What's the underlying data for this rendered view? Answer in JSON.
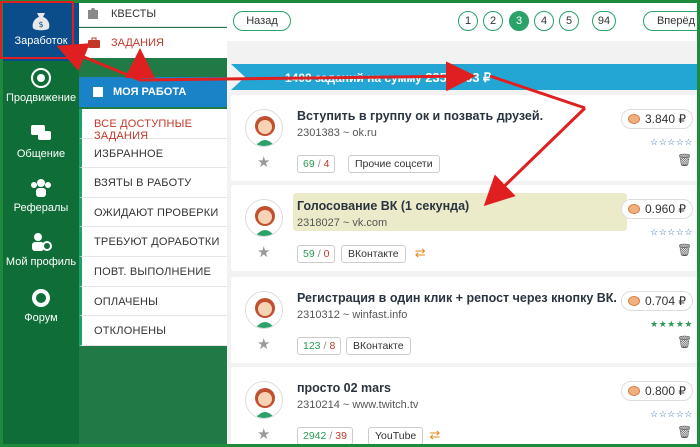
{
  "nav": {
    "items": [
      {
        "label": "Заработок",
        "icon": "money-bag-icon",
        "active": true
      },
      {
        "label": "Продвижение",
        "icon": "target-icon"
      },
      {
        "label": "Общение",
        "icon": "chat-icon"
      },
      {
        "label": "Рефералы",
        "icon": "people-icon"
      },
      {
        "label": "Мой профиль",
        "icon": "user-gear-icon"
      },
      {
        "label": "Форум",
        "icon": "forum-icon"
      }
    ]
  },
  "submenu": {
    "quests": "КВЕСТЫ",
    "tasks": "ЗАДАНИЯ",
    "my_work": "МОЯ РАБОТА",
    "items": [
      "ВСЕ ДОСТУПНЫЕ ЗАДАНИЯ",
      "ИЗБРАННОЕ",
      "ВЗЯТЫ В РАБОТУ",
      "ОЖИДАЮТ ПРОВЕРКИ",
      "ТРЕБУЮТ ДОРАБОТКИ",
      "ПОВТ. ВЫПОЛНЕНИЕ",
      "ОПЛАЧЕНЫ",
      "ОТКЛОНЕНЫ"
    ]
  },
  "pager": {
    "back": "Назад",
    "pages": [
      "1",
      "2",
      "3",
      "4",
      "5",
      "94"
    ],
    "current": "3",
    "forward": "Вперёд"
  },
  "banner": {
    "count_text": "1408 заданий на сумму",
    "sum": "2356.563 ₽"
  },
  "tasks": [
    {
      "title": "Вступить в группу ок и позвать друзей.",
      "id_site": "2301383 ~ ok.ru",
      "done": "69",
      "rejected": "4",
      "category": "Прочие соцсети",
      "price": "3.840 ₽",
      "stars": "☆☆☆☆☆",
      "repeat": false,
      "highlight": false
    },
    {
      "title": "Голосование ВК (1 секунда)",
      "id_site": "2318027 ~ vk.com",
      "done": "59",
      "rejected": "0",
      "category": "ВКонтакте",
      "price": "0.960 ₽",
      "stars": "☆☆☆☆☆",
      "repeat": true,
      "highlight": true
    },
    {
      "title": "Регистрация в один клик + репост через кнопку ВК.",
      "id_site": "2310312 ~ winfast.info",
      "done": "123",
      "rejected": "8",
      "category": "ВКонтакте",
      "price": "0.704 ₽",
      "stars": "★★★★★",
      "repeat": false,
      "highlight": false
    },
    {
      "title": "просто 02 mars",
      "id_site": "2310214 ~ www.twitch.tv",
      "done": "2942",
      "rejected": "39",
      "category": "YouTube",
      "price": "0.800 ₽",
      "stars": "☆☆☆☆☆",
      "repeat": true,
      "highlight": false
    }
  ],
  "colors": {
    "nav_bg": "#0f6e38",
    "accent": "#2aa26a",
    "banner": "#24a6d4",
    "arrow": "#e02020"
  }
}
